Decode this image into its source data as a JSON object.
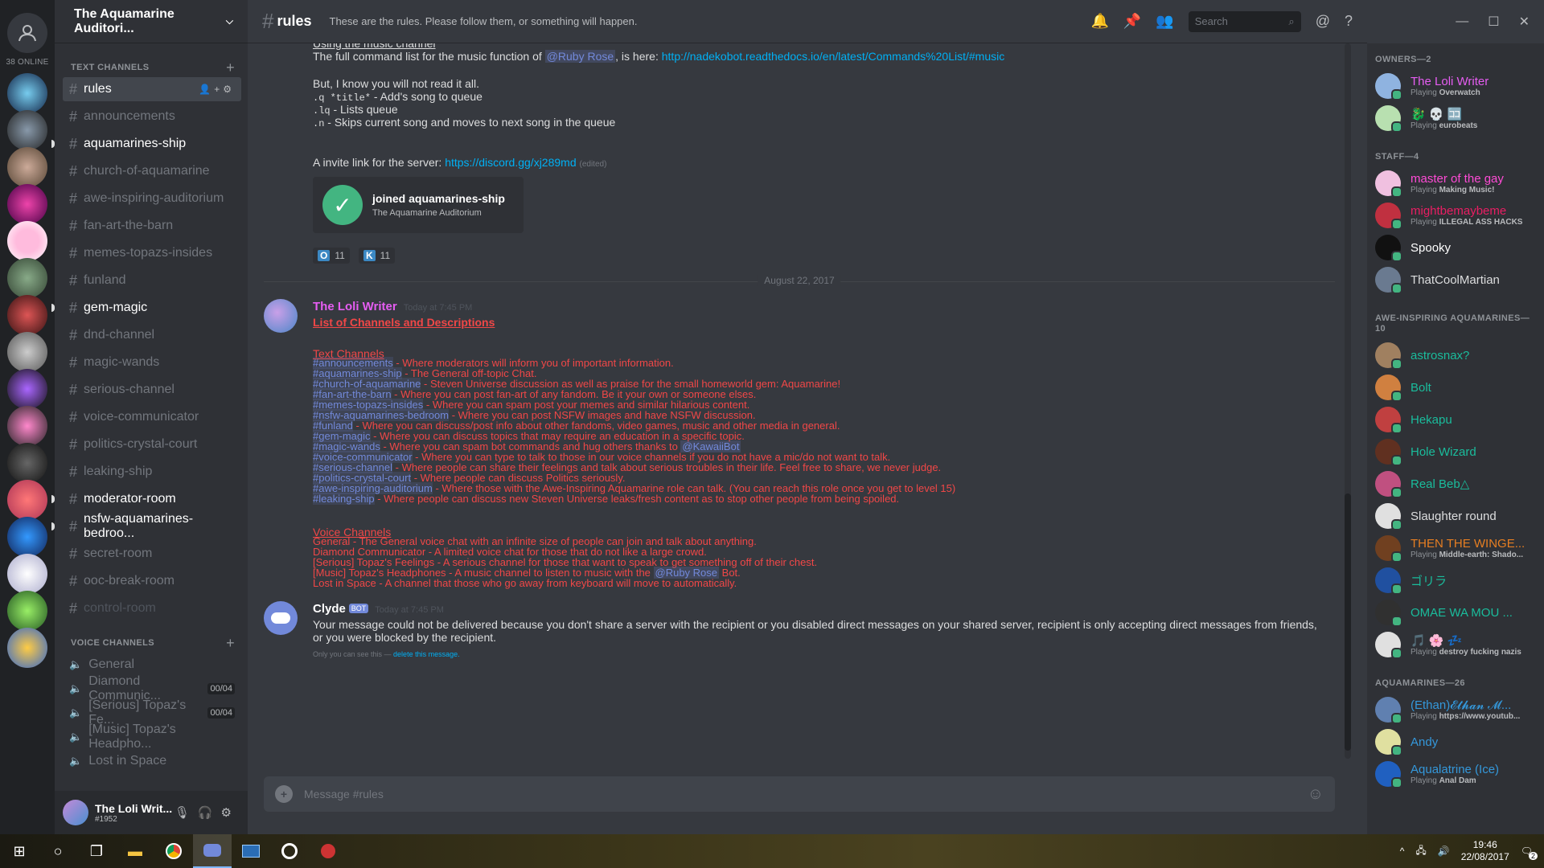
{
  "rail": {
    "online": "38 ONLINE"
  },
  "guild": {
    "name": "The Aquamarine Auditori..."
  },
  "text_category": "TEXT CHANNELS",
  "voice_category": "VOICE CHANNELS",
  "text_channels": [
    {
      "name": "rules",
      "state": "selected"
    },
    {
      "name": "announcements",
      "state": "read"
    },
    {
      "name": "aquamarines-ship",
      "state": "unread"
    },
    {
      "name": "church-of-aquamarine",
      "state": "read"
    },
    {
      "name": "awe-inspiring-auditorium",
      "state": "read"
    },
    {
      "name": "fan-art-the-barn",
      "state": "read"
    },
    {
      "name": "memes-topazs-insides",
      "state": "read"
    },
    {
      "name": "funland",
      "state": "read"
    },
    {
      "name": "gem-magic",
      "state": "unread"
    },
    {
      "name": "dnd-channel",
      "state": "read"
    },
    {
      "name": "magic-wands",
      "state": "read"
    },
    {
      "name": "serious-channel",
      "state": "read"
    },
    {
      "name": "voice-communicator",
      "state": "read"
    },
    {
      "name": "politics-crystal-court",
      "state": "read"
    },
    {
      "name": "leaking-ship",
      "state": "read"
    },
    {
      "name": "moderator-room",
      "state": "unread"
    },
    {
      "name": "nsfw-aquamarines-bedroo...",
      "state": "unread"
    },
    {
      "name": "secret-room",
      "state": "read"
    },
    {
      "name": "ooc-break-room",
      "state": "read"
    },
    {
      "name": "control-room",
      "state": "muted"
    }
  ],
  "voice_channels": [
    {
      "name": "General",
      "count": ""
    },
    {
      "name": "Diamond Communic...",
      "count": "00/04"
    },
    {
      "name": "[Serious] Topaz's Fe...",
      "count": "00/04"
    },
    {
      "name": "[Music] Topaz's Headpho...",
      "count": ""
    },
    {
      "name": "Lost in Space",
      "count": ""
    }
  ],
  "user": {
    "name": "The Loli Writ...",
    "tag": "#1952"
  },
  "topbar": {
    "channel": "rules",
    "topic": "These are the rules. Please follow them, or something will happen.",
    "search_placeholder": "Search"
  },
  "messages": {
    "music_heading": "Using the music channel",
    "music_line_pre": "The full command list for the music function of ",
    "music_mention": "@Ruby Rose",
    "music_line_mid": ", is here: ",
    "music_link": "http://nadekobot.readthedocs.io/en/latest/Commands%20List/#music",
    "but_line": "But, I know you will not read it all.",
    "cmd1_code": ".q *title*",
    "cmd1_text": " - Add's song to queue",
    "cmd2_code": ".lq",
    "cmd2_text": " - Lists queue",
    "cmd3_code": ".n",
    "cmd3_text": " - Skips current song and moves to next song in the queue",
    "invite_pre": "A invite link for the server: ",
    "invite_link": "https://discord.gg/xj289md",
    "invite_edited": "(edited)",
    "embed_title": "joined aquamarines-ship",
    "embed_sub": "The Aquamarine Auditorium",
    "reaction1": {
      "emoji": "O",
      "count": "11"
    },
    "reaction2": {
      "emoji": "K",
      "count": "11"
    },
    "date_sep": "August 22, 2017",
    "author1": "The Loli Writer",
    "ts1": "Today at 7:45 PM",
    "list_title": "List of Channels and Descriptions",
    "text_heading": "Text Channels",
    "rows": [
      {
        "ch": "#announcements",
        "desc": " - Where moderators will inform you of important information."
      },
      {
        "ch": "#aquamarines-ship",
        "desc": " - The General off-topic Chat."
      },
      {
        "ch": "#church-of-aquamarine",
        "desc": " - Steven Universe discussion as well as praise for the small homeworld gem: Aquamarine!"
      },
      {
        "ch": "#fan-art-the-barn",
        "desc": " - Where you can post fan-art of any fandom. Be it your own or someone elses."
      },
      {
        "ch": "#memes-topazs-insides",
        "desc": " - Where you can spam post your memes and similar hilarious content."
      },
      {
        "ch": "#nsfw-aquamarines-bedroom",
        "desc": " - Where you can post NSFW images and have NSFW discussion."
      },
      {
        "ch": "#funland",
        "desc": " - Where you can discuss/post info about other fandoms, video games, music and other media in general."
      },
      {
        "ch": "#gem-magic",
        "desc": "  - Where you can discuss topics that may require an education in a specific topic."
      },
      {
        "ch": "#magic-wands",
        "desc": " - Where you can spam bot commands and hug others thanks to "
      },
      {
        "ch": "#voice-communicator",
        "desc": " - Where you can type to talk to those in our voice channels if you do not have a mic/do not want to talk."
      },
      {
        "ch": "#serious-channel",
        "desc": " - Where people can share their feelings and talk about serious troubles in their life. Feel free to share, we never judge."
      },
      {
        "ch": "#politics-crystal-court",
        "desc": " - Where people can discuss Politics seriously."
      },
      {
        "ch": "#awe-inspiring-auditorium",
        "desc": " - Where those with the Awe-Inspiring Aquamarine role can talk. (You can reach this role once you get to level 15)"
      },
      {
        "ch": "#leaking-ship",
        "desc": " - Where people can discuss new Steven Universe leaks/fresh content as to stop other people from being spoiled."
      }
    ],
    "kawaii_mention": "@KawaiiBot",
    "voice_heading": "Voice Channels",
    "voice_rows": [
      "General - The General voice chat with an infinite size of people can join and talk about anything.",
      "Diamond Communicator - A limited voice chat for those that do not like a large crowd.",
      "[Serious] Topaz's Feelings - A serious channel for those that want to speak to get something off of their chest.",
      "[Music] Topaz's Headphones - A music channel to listen to music with the ",
      "Lost in Space - A channel that those who go away from keyboard will move to automatically."
    ],
    "ruby_mention": "@Ruby Rose",
    "bot_suffix": " Bot.",
    "author2": "Clyde",
    "bot_tag": "BOT",
    "ts2": "Today at 7:45 PM",
    "clyde_text": "Your message could not be delivered because you don't share a server with the recipient or you disabled direct messages on your shared server, recipient is only accepting direct messages from friends, or you were blocked by the recipient.",
    "only_you": "Only you can see this — ",
    "delete_link": "delete this message."
  },
  "composer": {
    "placeholder": "Message #rules"
  },
  "members": [
    {
      "header": "OWNERS—2",
      "list": [
        {
          "name": "The Loli Writer",
          "playing": "Overwatch",
          "color": "#e65df2",
          "av": "#8fb3e0"
        },
        {
          "name": "🐉 💀 🈁",
          "playing": "eurobeats",
          "color": "#dcddde",
          "av": "#b8e0b0"
        }
      ]
    },
    {
      "header": "STAFF—4",
      "list": [
        {
          "name": "master of the gay",
          "playing": "Making Music!",
          "color": "#ff4bd6",
          "av": "#f0c0e0"
        },
        {
          "name": "mightbemaybeme",
          "playing": "ILLEGAL ASS HACKS",
          "color": "#e91e63",
          "av": "#c03040"
        },
        {
          "name": "Spooky",
          "playing": "",
          "color": "#ffffff",
          "av": "#111111"
        },
        {
          "name": "ThatCoolMartian",
          "playing": "",
          "color": "#dcddde",
          "av": "#6a7a90"
        }
      ]
    },
    {
      "header": "AWE-INSPIRING AQUAMARINES—10",
      "list": [
        {
          "name": "astrosnax?",
          "playing": "",
          "color": "#1abc9c",
          "av": "#a08060"
        },
        {
          "name": "Bolt",
          "playing": "",
          "color": "#1abc9c",
          "av": "#d08040"
        },
        {
          "name": "Hekapu",
          "playing": "",
          "color": "#1abc9c",
          "av": "#c04040"
        },
        {
          "name": "Hole Wizard",
          "playing": "",
          "color": "#1abc9c",
          "av": "#603020"
        },
        {
          "name": "Real Beb△",
          "playing": "",
          "color": "#1abc9c",
          "av": "#c05080"
        },
        {
          "name": "Slaughter round",
          "playing": "",
          "color": "#dcddde",
          "av": "#e0e0e0"
        },
        {
          "name": "THEN THE WINGE...",
          "playing": "Middle-earth: Shado...",
          "color": "#e67e22",
          "av": "#704020"
        },
        {
          "name": "ゴリラ",
          "playing": "",
          "color": "#1abc9c",
          "av": "#2050a0"
        },
        {
          "name": "OMAE WA MOU ...",
          "playing": "",
          "color": "#1abc9c",
          "av": "#303030"
        },
        {
          "name": "🎵 🌸 💤",
          "playing": "destroy fucking nazis",
          "color": "#dcddde",
          "av": "#e0e0e0"
        }
      ]
    },
    {
      "header": "AQUAMARINES—26",
      "list": [
        {
          "name": "(Ethan)𝓔𝓽𝓱𝓪𝓷 𝓜...",
          "playing": "https://www.youtub...",
          "color": "#3498db",
          "av": "#6080b0"
        },
        {
          "name": "Andy",
          "playing": "",
          "color": "#3498db",
          "av": "#e0e0a0"
        },
        {
          "name": "Aqualatrine (Ice)",
          "playing": "Anal Dam",
          "color": "#3498db",
          "av": "#2060c0"
        }
      ]
    }
  ],
  "playing_prefix": "Playing ",
  "taskbar": {
    "time": "19:46",
    "date": "22/08/2017",
    "notif": "2"
  }
}
